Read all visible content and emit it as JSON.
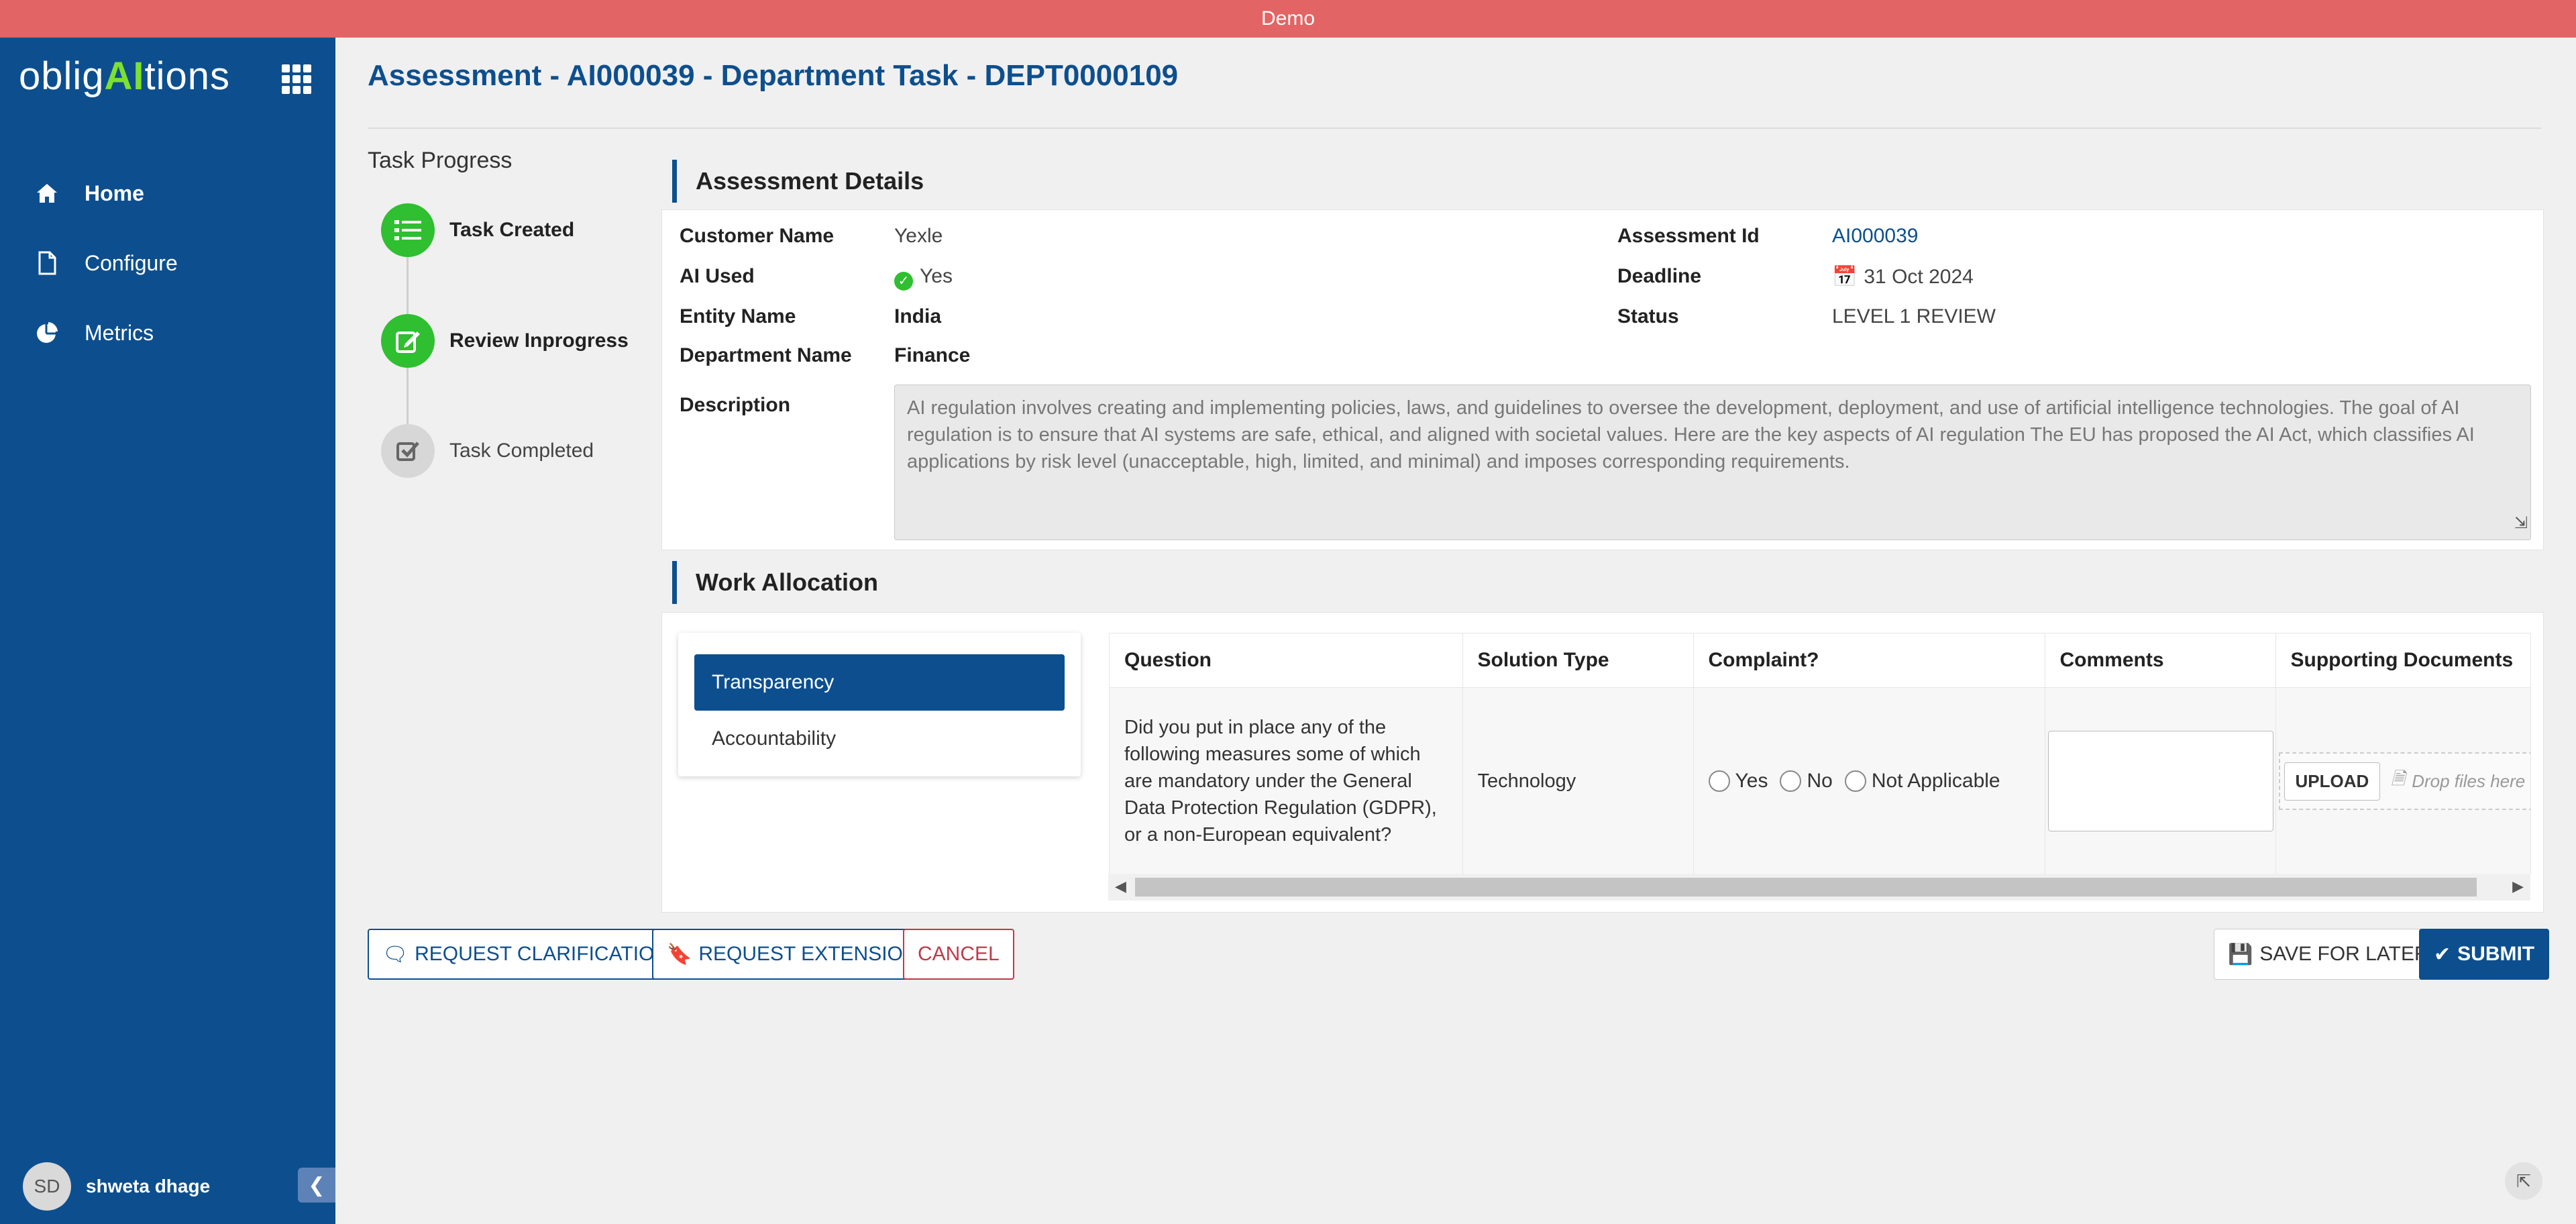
{
  "banner": {
    "text": "Demo"
  },
  "sidebar": {
    "brand": {
      "part1": "oblig",
      "part2": "AI",
      "part3": "tions"
    },
    "items": [
      {
        "label": "Home",
        "icon": "home-icon",
        "active": true
      },
      {
        "label": "Configure",
        "icon": "file-icon",
        "active": false
      },
      {
        "label": "Metrics",
        "icon": "pie-chart-icon",
        "active": false
      }
    ],
    "user": {
      "initials": "SD",
      "name": "shweta dhage"
    }
  },
  "page": {
    "title": "Assessment - AI000039 - Department Task - DEPT0000109"
  },
  "progress": {
    "title": "Task Progress",
    "steps": [
      {
        "label": "Task Created",
        "status": "done"
      },
      {
        "label": "Review Inprogress",
        "status": "done"
      },
      {
        "label": "Task Completed",
        "status": "pending"
      }
    ]
  },
  "details": {
    "heading": "Assessment Details",
    "customer_name_label": "Customer Name",
    "customer_name": "Yexle",
    "ai_used_label": "AI Used",
    "ai_used": "Yes",
    "entity_name_label": "Entity Name",
    "entity_name": "India",
    "department_name_label": "Department Name",
    "department_name": "Finance",
    "assessment_id_label": "Assessment Id",
    "assessment_id": "AI000039",
    "deadline_label": "Deadline",
    "deadline": "31 Oct 2024",
    "status_label": "Status",
    "status": "LEVEL 1 REVIEW",
    "description_label": "Description",
    "description": "AI regulation involves creating and implementing policies, laws, and guidelines to oversee the development, deployment, and use of artificial intelligence technologies. The goal of AI regulation is to ensure that AI systems are safe, ethical, and aligned with societal values. Here are the key aspects of AI regulation The EU has proposed the AI Act, which classifies AI applications by risk level (unacceptable, high, limited, and minimal) and imposes corresponding requirements."
  },
  "work": {
    "heading": "Work Allocation",
    "tabs": [
      {
        "label": "Transparency",
        "active": true
      },
      {
        "label": "Accountability",
        "active": false
      }
    ],
    "columns": [
      "Question",
      "Solution Type",
      "Complaint?",
      "Comments",
      "Supporting Documents"
    ],
    "rows": [
      {
        "question": "Did you put in place any of the following measures some of which are mandatory under the General Data Protection Regulation (GDPR), or a non-European equivalent?",
        "solution_type": "Technology",
        "options": [
          "Yes",
          "No",
          "Not Applicable"
        ],
        "comment": "",
        "upload_label": "UPLOAD",
        "drop_hint": "Drop files here"
      }
    ]
  },
  "actions": {
    "request_clarification": "REQUEST CLARIFICATION",
    "request_extension": "REQUEST EXTENSION",
    "cancel": "CANCEL",
    "save_for_later": "SAVE FOR LATER",
    "submit": "SUBMIT"
  },
  "colors": {
    "brand_blue": "#0d4f8e",
    "banner_red": "#e36464",
    "accent_green": "#7ee02e",
    "success_green": "#2fbf30",
    "cancel_red": "#c0394b"
  }
}
